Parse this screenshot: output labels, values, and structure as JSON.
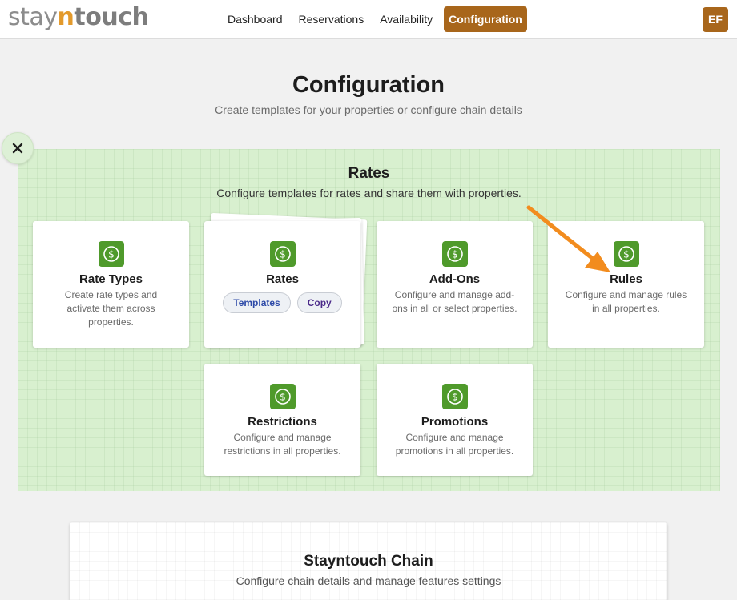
{
  "header": {
    "logo_prefix": "stay",
    "logo_n": "n",
    "logo_suffix": "touch",
    "nav": [
      {
        "label": "Dashboard"
      },
      {
        "label": "Reservations"
      },
      {
        "label": "Availability"
      },
      {
        "label": "Configuration"
      }
    ],
    "active_nav": "Configuration",
    "avatar_initials": "EF"
  },
  "page": {
    "title": "Configuration",
    "subtitle": "Create templates for your properties or configure chain details"
  },
  "close_button": {
    "icon": "close-icon"
  },
  "rates_section": {
    "title": "Rates",
    "subtitle": "Configure templates for rates and share them with properties.",
    "cards": [
      {
        "title": "Rate Types",
        "desc": "Create rate types and activate them across properties.",
        "icon": "dollar-icon"
      },
      {
        "title": "Rates",
        "desc": "",
        "icon": "dollar-icon",
        "pills": [
          "Templates",
          "Copy"
        ]
      },
      {
        "title": "Add-Ons",
        "desc": "Configure and manage add-ons in all or select properties.",
        "icon": "dollar-icon"
      },
      {
        "title": "Rules",
        "desc": "Configure and manage rules in all properties.",
        "icon": "dollar-icon"
      },
      {
        "title": "Restrictions",
        "desc": "Configure and manage restrictions in all properties.",
        "icon": "dollar-icon"
      },
      {
        "title": "Promotions",
        "desc": "Configure and manage promotions in all properties.",
        "icon": "dollar-icon"
      }
    ]
  },
  "chain_section": {
    "title": "Stayntouch Chain",
    "subtitle": "Configure chain details and manage features settings"
  },
  "colors": {
    "brand": "#a8661b",
    "icon_green": "#4f9a2b",
    "panel_green": "#d8f0cf",
    "arrow_orange": "#f28c1e"
  }
}
